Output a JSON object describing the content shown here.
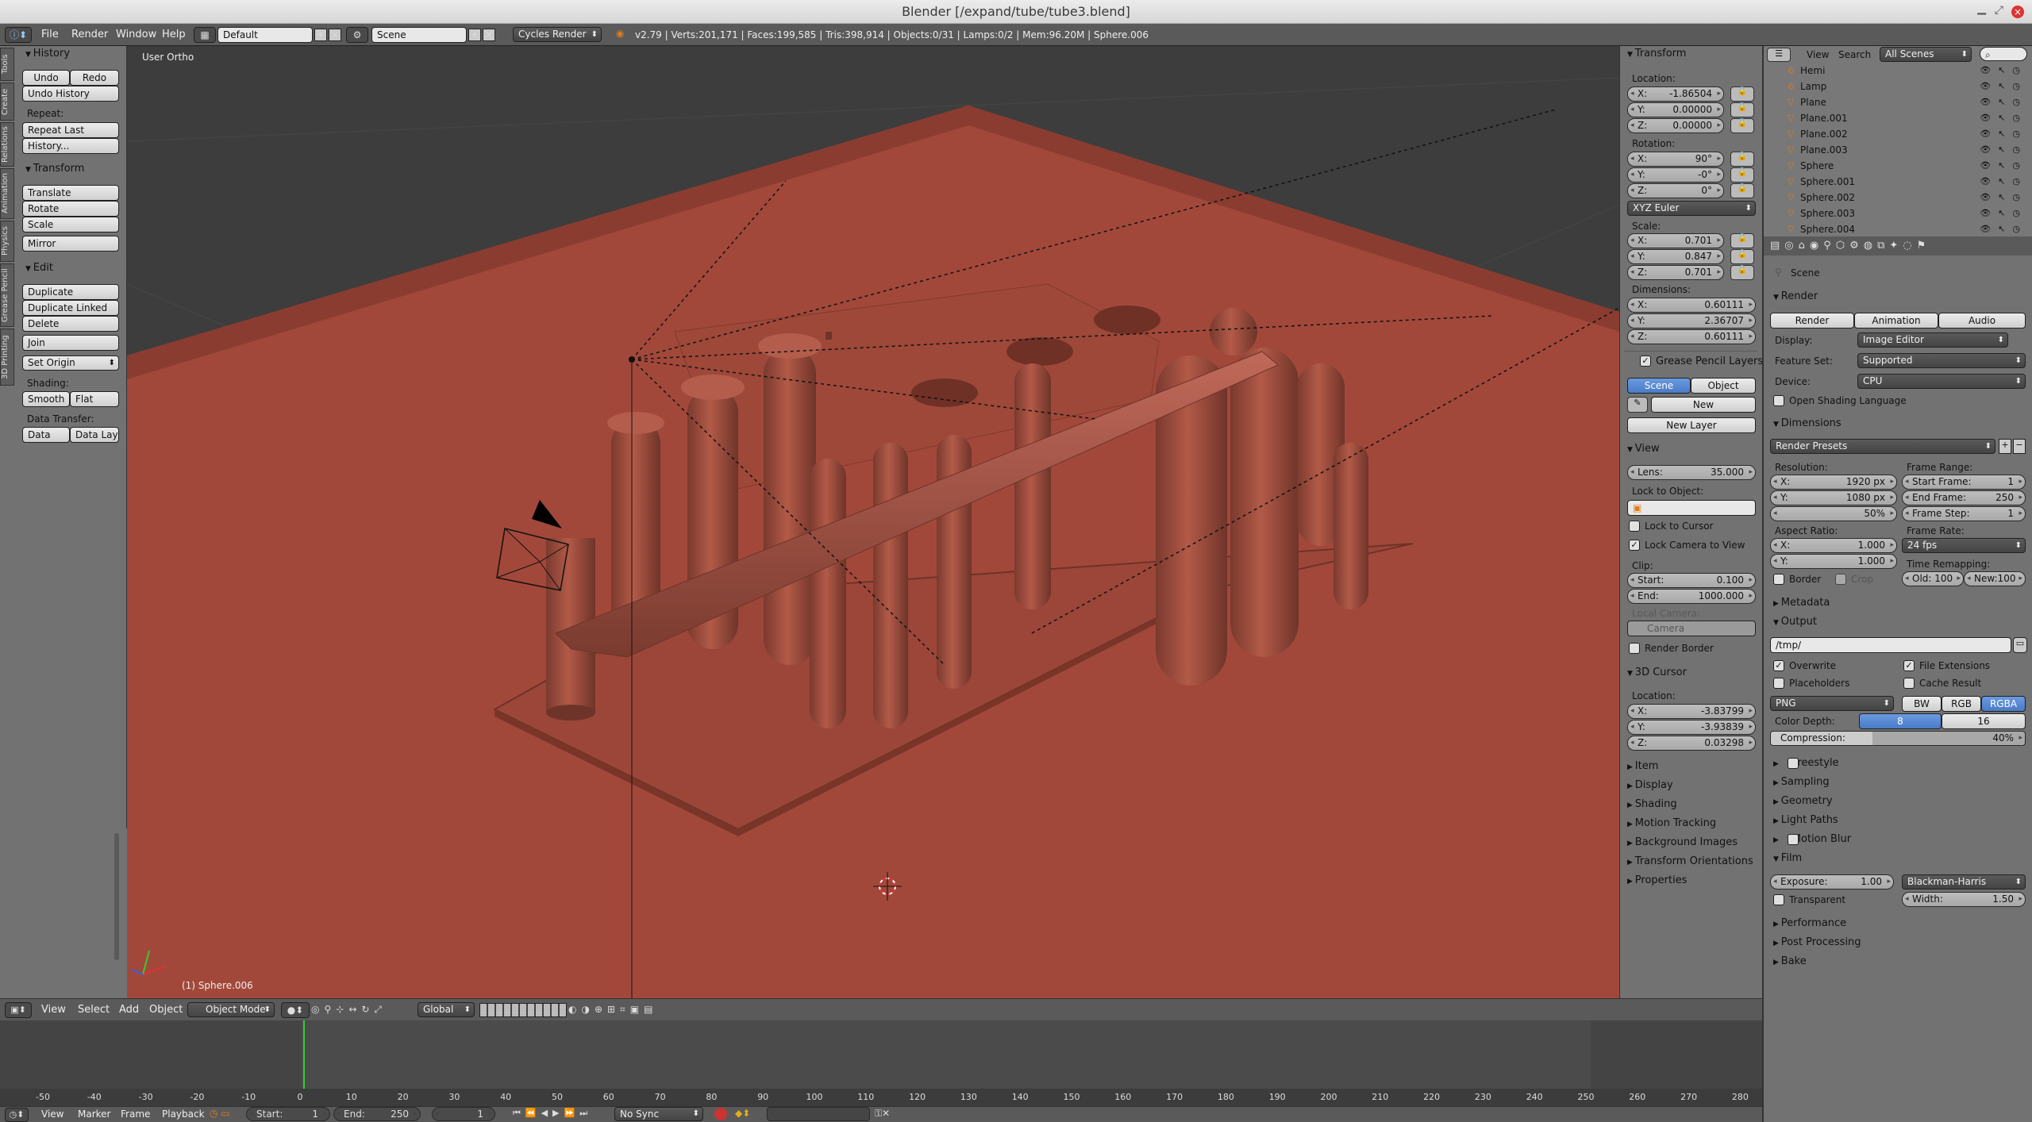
{
  "window": {
    "title": "Blender [/expand/tube/tube3.blend]",
    "close_icon": "×"
  },
  "info": {
    "menus": [
      "File",
      "Render",
      "Window",
      "Help"
    ],
    "layout": "Default",
    "scene": "Scene",
    "engine": "Cycles Render",
    "stats": "v2.79 | Verts:201,171 | Faces:199,585 | Tris:398,914 | Objects:0/31 | Lamps:0/2 | Mem:96.20M | Sphere.006"
  },
  "tools": {
    "tabs": [
      "Tools",
      "Create",
      "Relations",
      "Animation",
      "Physics",
      "Grease Pencil",
      "3D Printing"
    ],
    "history": {
      "title": "History",
      "undo": "Undo",
      "redo": "Redo",
      "undo_history": "Undo History",
      "repeat": "Repeat:",
      "repeat_last": "Repeat Last",
      "history": "History..."
    },
    "transform": {
      "title": "Transform",
      "translate": "Translate",
      "rotate": "Rotate",
      "scale": "Scale",
      "mirror": "Mirror"
    },
    "edit": {
      "title": "Edit",
      "duplicate": "Duplicate",
      "duplicate_linked": "Duplicate Linked",
      "delete": "Delete",
      "join": "Join",
      "set_origin": "Set Origin",
      "shading": "Shading:",
      "smooth": "Smooth",
      "flat": "Flat",
      "data_transfer": "Data Transfer:",
      "data": "Data",
      "data_layo": "Data Layo"
    }
  },
  "viewport": {
    "view_name": "User Ortho",
    "selected": "(1) Sphere.006"
  },
  "n_panel": {
    "transform": {
      "title": "Transform",
      "location": "Location:",
      "loc": [
        {
          "k": "X:",
          "v": "-1.86504"
        },
        {
          "k": "Y:",
          "v": "0.00000"
        },
        {
          "k": "Z:",
          "v": "0.00000"
        }
      ],
      "rotation": "Rotation:",
      "rot": [
        {
          "k": "X:",
          "v": "90°"
        },
        {
          "k": "Y:",
          "v": "-0°"
        },
        {
          "k": "Z:",
          "v": "0°"
        }
      ],
      "rot_mode": "XYZ Euler",
      "scale": "Scale:",
      "scl": [
        {
          "k": "X:",
          "v": "0.701"
        },
        {
          "k": "Y:",
          "v": "0.847"
        },
        {
          "k": "Z:",
          "v": "0.701"
        }
      ],
      "dimensions": "Dimensions:",
      "dim": [
        {
          "k": "X:",
          "v": "0.60111"
        },
        {
          "k": "Y:",
          "v": "2.36707"
        },
        {
          "k": "Z:",
          "v": "0.60111"
        }
      ]
    },
    "gp": {
      "title": "Grease Pencil Layers",
      "scene": "Scene",
      "object": "Object",
      "new": "New",
      "new_layer": "New Layer"
    },
    "view": {
      "title": "View",
      "lens_k": "Lens:",
      "lens_v": "35.000",
      "lock_to_object": "Lock to Object:",
      "lock_to_cursor": "Lock to Cursor",
      "lock_camera": "Lock Camera to View",
      "clip": "Clip:",
      "start_k": "Start:",
      "start_v": "0.100",
      "end_k": "End:",
      "end_v": "1000.000",
      "local_camera": "Local Camera:",
      "camera": "Camera",
      "render_border": "Render Border"
    },
    "cursor": {
      "title": "3D Cursor",
      "location": "Location:",
      "loc": [
        {
          "k": "X:",
          "v": "-3.83799"
        },
        {
          "k": "Y:",
          "v": "-3.93839"
        },
        {
          "k": "Z:",
          "v": "0.03298"
        }
      ]
    },
    "closed": [
      "Item",
      "Display",
      "Shading",
      "Motion Tracking",
      "Background Images",
      "Transform Orientations",
      "Properties"
    ]
  },
  "outliner": {
    "menus": [
      "View",
      "Search"
    ],
    "scope": "All Scenes",
    "items": [
      "Hemi",
      "Lamp",
      "Plane",
      "Plane.001",
      "Plane.002",
      "Plane.003",
      "Sphere",
      "Sphere.001",
      "Sphere.002",
      "Sphere.003",
      "Sphere.004"
    ]
  },
  "props": {
    "breadcrumb": "Scene",
    "render": {
      "title": "Render",
      "render": "Render",
      "animation": "Animation",
      "audio": "Audio",
      "display_k": "Display:",
      "display_v": "Image Editor",
      "feature_k": "Feature Set:",
      "feature_v": "Supported",
      "device_k": "Device:",
      "device_v": "CPU",
      "osl": "Open Shading Language"
    },
    "dimensions": {
      "title": "Dimensions",
      "presets": "Render Presets",
      "resolution": "Resolution:",
      "res_x": "1920 px",
      "res_y": "1080 px",
      "res_pct": "50%",
      "frame_range": "Frame Range:",
      "start_frame_k": "Start Frame:",
      "start_frame_v": "1",
      "end_frame_k": "End Frame:",
      "end_frame_v": "250",
      "frame_step_k": "Frame Step:",
      "frame_step_v": "1",
      "aspect": "Aspect Ratio:",
      "asp_x": "1.000",
      "asp_y": "1.000",
      "frame_rate": "Frame Rate:",
      "fps": "24 fps",
      "border": "Border",
      "crop": "Crop",
      "time_remap": "Time Remapping:",
      "old": "Old: 100",
      "new": "New:100"
    },
    "metadata": "Metadata",
    "output": {
      "title": "Output",
      "path": "/tmp/",
      "overwrite": "Overwrite",
      "file_ext": "File Extensions",
      "placeholders": "Placeholders",
      "cache": "Cache Result",
      "format": "PNG",
      "bw": "BW",
      "rgb": "RGB",
      "rgba": "RGBA",
      "depth_k": "Color Depth:",
      "depth_8": "8",
      "depth_16": "16",
      "compression": "Compression:",
      "compression_v": "40%",
      "compression_level": 0.4
    },
    "closed": [
      "Freestyle",
      "Sampling",
      "Geometry",
      "Light Paths",
      "Motion Blur"
    ],
    "film": {
      "title": "Film",
      "exposure_k": "Exposure:",
      "exposure_v": "1.00",
      "filter": "Blackman-Harris",
      "transparent": "Transparent",
      "width_k": "Width:",
      "width_v": "1.50"
    },
    "closed2": [
      "Performance",
      "Post Processing",
      "Bake"
    ]
  },
  "vp_header": {
    "menus": [
      "View",
      "Select",
      "Add",
      "Object"
    ],
    "mode": "Object Mode",
    "orientation": "Global"
  },
  "timeline": {
    "ticks": [
      "-50",
      "-40",
      "-30",
      "-20",
      "-10",
      "0",
      "10",
      "20",
      "30",
      "40",
      "50",
      "60",
      "70",
      "80",
      "90",
      "100",
      "110",
      "120",
      "130",
      "140",
      "150",
      "160",
      "170",
      "180",
      "190",
      "200",
      "210",
      "220",
      "230",
      "240",
      "250",
      "260",
      "270",
      "280"
    ],
    "menus": [
      "View",
      "Marker",
      "Frame",
      "Playback"
    ],
    "start_k": "Start:",
    "start_v": "1",
    "end_k": "End:",
    "end_v": "250",
    "current": "1",
    "sync": "No Sync"
  }
}
